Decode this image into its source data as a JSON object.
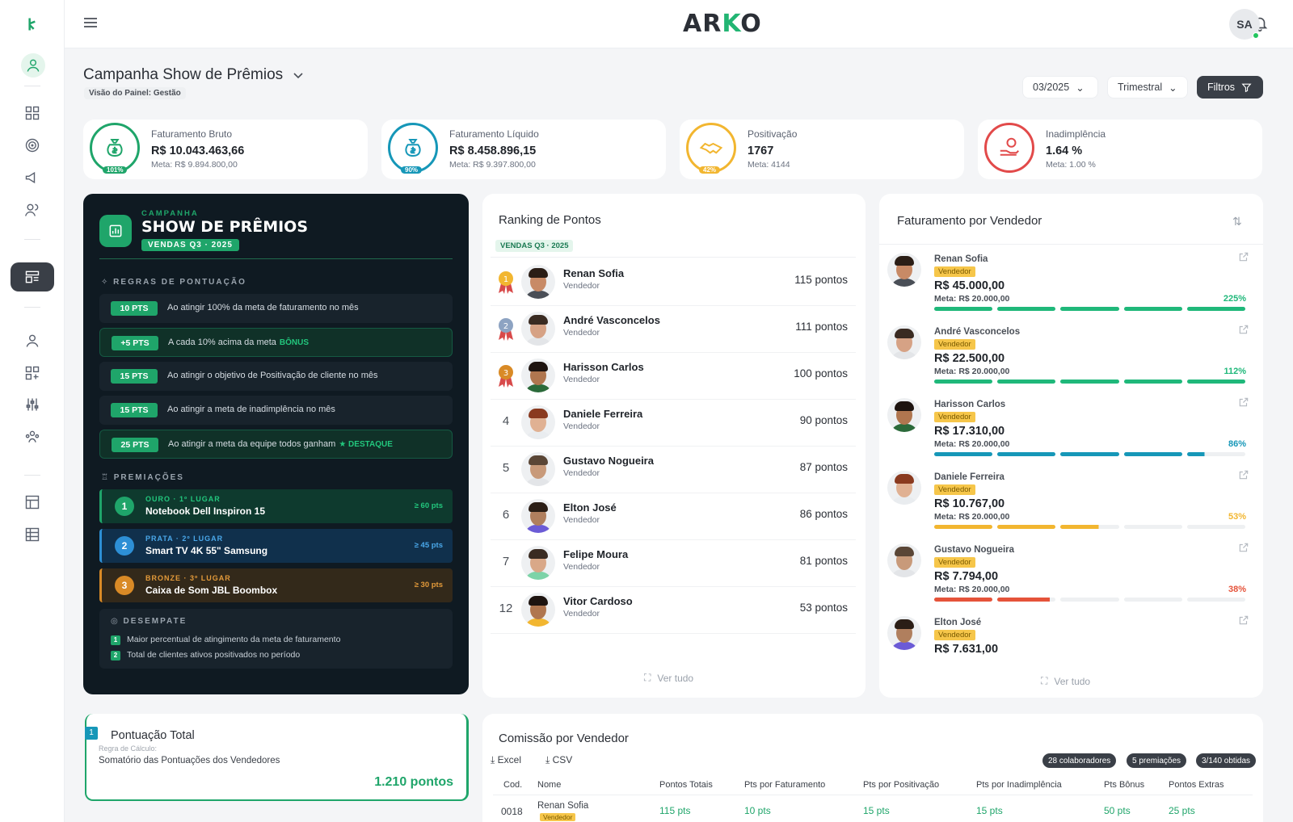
{
  "sidebar": {
    "items": [
      "logo-icon",
      "user-icon",
      "dashboard-icon",
      "target-icon",
      "megaphone-icon",
      "users-icon",
      "layout-icon",
      "person-icon",
      "apps-icon",
      "sliders-icon",
      "team-icon",
      "table-add-icon",
      "table-icon"
    ]
  },
  "topbar": {
    "logo_left": "AR",
    "logo_accent": "K",
    "logo_right": "O",
    "avatar_initials": "SA"
  },
  "header": {
    "title": "Campanha Show de Prêmios",
    "subtitle": "Visão do Painel: Gestão",
    "period": "03/2025",
    "frequency": "Trimestral",
    "filters_label": "Filtros"
  },
  "kpis": [
    {
      "label": "Faturamento Bruto",
      "value": "R$ 10.043.463,66",
      "meta": "Meta: R$ 9.894.800,00",
      "pct": "101%",
      "color": "#1fa56a"
    },
    {
      "label": "Faturamento Líquido",
      "value": "R$ 8.458.896,15",
      "meta": "Meta: R$ 9.397.800,00",
      "pct": "90%",
      "color": "#1697b8"
    },
    {
      "label": "Positivação",
      "value": "1767",
      "meta": "Meta: 4144",
      "pct": "42%",
      "color": "#f2b630"
    },
    {
      "label": "Inadimplência",
      "value": "1.64 %",
      "meta": "Meta: 1.00 %",
      "pct": "",
      "color": "#e24a4a"
    }
  ],
  "campaign": {
    "kicker": "CAMPANHA",
    "title": "SHOW DE PRÊMIOS",
    "chip": "VENDAS Q3 · 2025",
    "rules_title": "REGRAS DE PONTUAÇÃO",
    "rules": [
      {
        "pts": "10 PTS",
        "text": "Ao atingir 100% da meta de faturamento no mês",
        "tag": ""
      },
      {
        "pts": "+5 PTS",
        "text": "A cada 10% acima da meta",
        "tag": "BÔNUS"
      },
      {
        "pts": "15 PTS",
        "text": "Ao atingir o objetivo de Positivação de cliente no mês",
        "tag": ""
      },
      {
        "pts": "15 PTS",
        "text": "Ao atingir a meta de inadimplência no mês",
        "tag": ""
      },
      {
        "pts": "25 PTS",
        "text": "Ao atingir a meta da equipe todos ganham",
        "tag": "★ DESTAQUE"
      }
    ],
    "prizes_title": "PREMIAÇÕES",
    "prizes": [
      {
        "num": "1",
        "rank": "OURO · 1º LUGAR",
        "name": "Notebook Dell Inspiron 15",
        "threshold": "≥ 60 pts"
      },
      {
        "num": "2",
        "rank": "PRATA · 2º LUGAR",
        "name": "Smart TV 4K 55\" Samsung",
        "threshold": "≥ 45 pts"
      },
      {
        "num": "3",
        "rank": "BRONZE · 3º LUGAR",
        "name": "Caixa de Som JBL Boombox",
        "threshold": "≥ 30 pts"
      }
    ],
    "tiebreak_title": "DESEMPATE",
    "tiebreak": [
      {
        "num": "1",
        "text": "Maior percentual de atingimento da meta de faturamento"
      },
      {
        "num": "2",
        "text": "Total de clientes ativos positivados no período"
      }
    ]
  },
  "ranking": {
    "title": "Ranking de Pontos",
    "chip": "VENDAS Q3 · 2025",
    "rows": [
      {
        "pos": "1",
        "name": "Renan Sofia",
        "role": "Vendedor",
        "score": "115 pontos"
      },
      {
        "pos": "2",
        "name": "André Vasconcelos",
        "role": "Vendedor",
        "score": "111 pontos"
      },
      {
        "pos": "3",
        "name": "Harisson Carlos",
        "role": "Vendedor",
        "score": "100 pontos"
      },
      {
        "pos": "4",
        "name": "Daniele Ferreira",
        "role": "Vendedor",
        "score": "90 pontos"
      },
      {
        "pos": "5",
        "name": "Gustavo Nogueira",
        "role": "Vendedor",
        "score": "87 pontos"
      },
      {
        "pos": "6",
        "name": "Elton José",
        "role": "Vendedor",
        "score": "86 pontos"
      },
      {
        "pos": "7",
        "name": "Felipe Moura",
        "role": "Vendedor",
        "score": "81 pontos"
      },
      {
        "pos": "12",
        "name": "Vitor Cardoso",
        "role": "Vendedor",
        "score": "53 pontos"
      }
    ],
    "see_all": "Ver tudo"
  },
  "billing": {
    "title": "Faturamento por Vendedor",
    "rows": [
      {
        "name": "Renan Sofia",
        "role": "Vendedor",
        "value": "R$ 45.000,00",
        "meta": "Meta: R$ 20.000,00",
        "pct": "225%",
        "fraction": 1.0,
        "color": "#1fb87a"
      },
      {
        "name": "André Vasconcelos",
        "role": "Vendedor",
        "value": "R$ 22.500,00",
        "meta": "Meta: R$ 20.000,00",
        "pct": "112%",
        "fraction": 1.0,
        "color": "#1fb87a"
      },
      {
        "name": "Harisson Carlos",
        "role": "Vendedor",
        "value": "R$ 17.310,00",
        "meta": "Meta: R$ 20.000,00",
        "pct": "86%",
        "fraction": 0.86,
        "color": "#1697b8"
      },
      {
        "name": "Daniele Ferreira",
        "role": "Vendedor",
        "value": "R$ 10.767,00",
        "meta": "Meta: R$ 20.000,00",
        "pct": "53%",
        "fraction": 0.53,
        "color": "#f2b630"
      },
      {
        "name": "Gustavo Nogueira",
        "role": "Vendedor",
        "value": "R$ 7.794,00",
        "meta": "Meta: R$ 20.000,00",
        "pct": "38%",
        "fraction": 0.38,
        "color": "#e5533a"
      },
      {
        "name": "Elton José",
        "role": "Vendedor",
        "value": "R$ 7.631,00",
        "meta": "",
        "pct": "",
        "fraction": 0,
        "color": "#1fb87a"
      }
    ],
    "see_all": "Ver tudo"
  },
  "score_total": {
    "num": "1",
    "title": "Pontuação Total",
    "rule_label": "Regra de Cálculo:",
    "rule": "Somatório das Pontuações dos Vendedores",
    "value": "1.210 pontos"
  },
  "commission": {
    "title": "Comissão por Vendedor",
    "excel": "Excel",
    "csv": "CSV",
    "pills": [
      "28 colaboradores",
      "5 premiações",
      "3/140 obtidas"
    ],
    "columns": [
      "Cod.",
      "Nome",
      "Pontos Totais",
      "Pts por Faturamento",
      "Pts por Positivação",
      "Pts por Inadimplência",
      "Pts Bônus",
      "Pontos Extras"
    ],
    "row": {
      "cod": "0018",
      "name": "Renan Sofia",
      "role": "Vendedor",
      "cells": [
        "115 pts",
        "10 pts",
        "15 pts",
        "15 pts",
        "50 pts",
        "25 pts"
      ]
    }
  }
}
